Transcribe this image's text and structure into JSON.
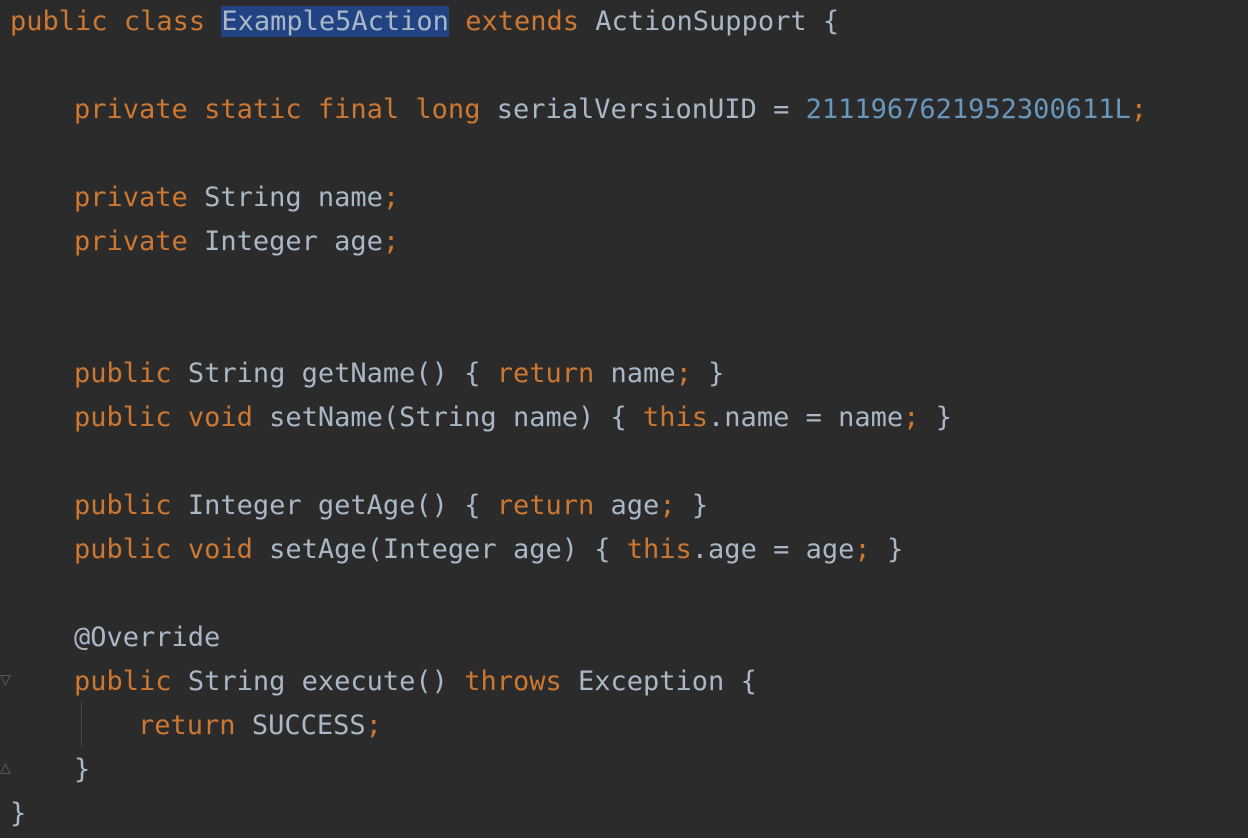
{
  "editor": {
    "theme": {
      "background": "#2b2b2b",
      "keyword": "#cc7832",
      "identifier": "#a9b7c6",
      "number": "#6897bb",
      "selection": "#214283"
    },
    "code": {
      "kw_public": "public",
      "kw_class": "class",
      "class_name": "Example5Action",
      "kw_extends": "extends",
      "super_class": "ActionSupport",
      "open_brace": "{",
      "kw_private": "private",
      "kw_static": "static",
      "kw_final": "final",
      "kw_long": "long",
      "serial_field": "serialVersionUID",
      "equals": "=",
      "serial_value": "2111967621952300611L",
      "semicolon": ";",
      "type_string": "String",
      "field_name": "name",
      "type_integer": "Integer",
      "field_age": "age",
      "getname_sig": "getName()",
      "kw_return": "return",
      "kw_void": "void",
      "setname_sig": "setName(String name)",
      "kw_this": "this",
      "dot_name": ".name",
      "getage_sig": "getAge()",
      "setage_sig": "setAge(Integer age)",
      "dot_age": ".age",
      "annotation_override": "@Override",
      "execute_sig": "execute()",
      "kw_throws": "throws",
      "exception_type": "Exception",
      "success_const": "SUCCESS",
      "close_brace": "}"
    }
  }
}
